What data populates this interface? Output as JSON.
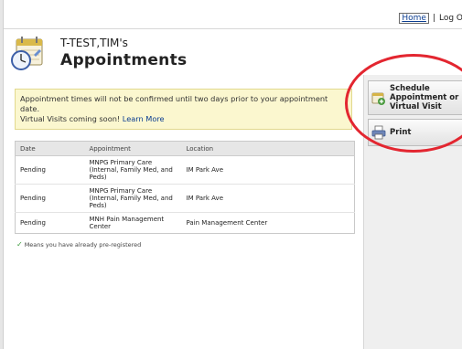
{
  "nav": {
    "home_label": "Home",
    "separator": "|",
    "logout_label": "Log O"
  },
  "header": {
    "patient_name": "T-TEST,TIM's",
    "title": "Appointments"
  },
  "notice": {
    "line1": "Appointment times will not be confirmed until two days prior to your appointment date.",
    "line2": "Virtual Visits coming soon!",
    "link_label": "Learn More"
  },
  "table": {
    "headers": [
      "Date",
      "Appointment",
      "Location"
    ],
    "rows": [
      {
        "date": "Pending",
        "appointment": "MNPG Primary Care (Internal, Family Med, and Peds)",
        "location": "IM Park Ave"
      },
      {
        "date": "Pending",
        "appointment": "MNPG Primary Care (Internal, Family Med, and Peds)",
        "location": "IM Park Ave"
      },
      {
        "date": "Pending",
        "appointment": "MNH Pain Management Center",
        "location": "Pain Management Center"
      }
    ]
  },
  "legend": {
    "text": "Means you have already pre-registered"
  },
  "side": {
    "schedule_label": "Schedule Appointment or Virtual Visit",
    "print_label": "Print"
  },
  "colors": {
    "annotation": "#e32630",
    "notice_bg": "#fbf7cf",
    "link": "#0b3d91"
  }
}
